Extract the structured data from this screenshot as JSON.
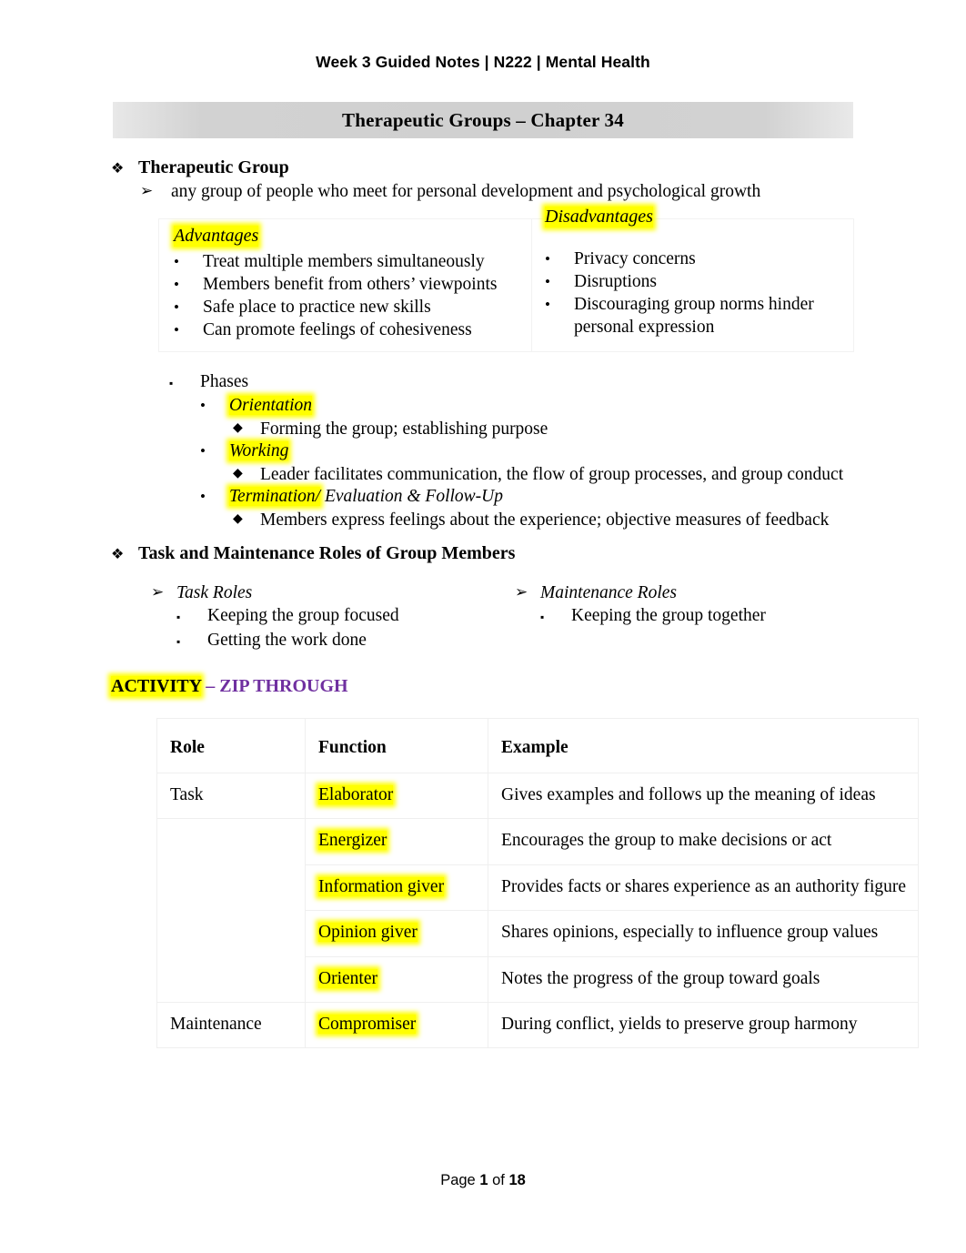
{
  "header": {
    "title": "Week 3 Guided Notes | N222 | Mental Health"
  },
  "banner": {
    "title": "Therapeutic Groups – Chapter 34"
  },
  "bullets": {
    "diamond": "❖",
    "arrow": "➢",
    "square": "▪",
    "dot": "•",
    "diamond_small": "◆"
  },
  "section1": {
    "heading": "Therapeutic Group",
    "definition": "any group of people who meet for personal development and psychological growth"
  },
  "pros_cons": {
    "advantages_label": "Advantages",
    "advantages": [
      "Treat multiple members simultaneously",
      "Members benefit from others’ viewpoints",
      "Safe place to practice new skills",
      "Can promote feelings of cohesiveness"
    ],
    "disadvantages_label": "Disadvantages",
    "disadvantages": [
      "Privacy concerns",
      "Disruptions",
      "Discouraging group norms hinder personal expression"
    ]
  },
  "phases": {
    "label": "Phases",
    "items": [
      {
        "name": "Orientation",
        "name_plain": "",
        "detail": "Forming the group; establishing purpose"
      },
      {
        "name": "Working",
        "name_plain": "",
        "detail": "Leader facilitates communication, the flow of group processes, and group conduct"
      },
      {
        "name": "Termination/",
        "name_plain": " Evaluation & Follow-Up",
        "detail": "Members express feelings about the experience; objective measures of feedback"
      }
    ]
  },
  "section2": {
    "heading": "Task and Maintenance Roles of Group Members",
    "task_roles_label": "Task Roles",
    "task_roles": [
      "Keeping the group focused",
      "Getting the work done"
    ],
    "maintenance_roles_label": "Maintenance Roles",
    "maintenance_roles": [
      "Keeping the group together"
    ]
  },
  "activity": {
    "label": "ACTIVITY",
    "separator_and_name": " – ZIP THROUGH",
    "purple_color": "#7030a0",
    "highlight_color": "#ffff00"
  },
  "roles_table": {
    "columns": [
      "Role",
      "Function",
      "Example"
    ],
    "rows": [
      {
        "role": "Task",
        "function": "Elaborator",
        "example": "Gives examples and follows up the meaning of ideas"
      },
      {
        "role": "",
        "function": "Energizer",
        "example": "Encourages the group to make decisions or act"
      },
      {
        "role": "",
        "function": "Information giver",
        "example": "Provides facts or shares experience as an authority figure"
      },
      {
        "role": "",
        "function": "Opinion giver",
        "example": "Shares opinions, especially to influence group values"
      },
      {
        "role": "",
        "function": "Orienter",
        "example": "Notes the progress of the group toward goals"
      },
      {
        "role": "Maintenance",
        "function": "Compromiser",
        "example": "During conflict, yields to preserve group harmony"
      }
    ]
  },
  "footer": {
    "prefix": "Page ",
    "page": "1",
    "middle": " of ",
    "total": "18"
  }
}
